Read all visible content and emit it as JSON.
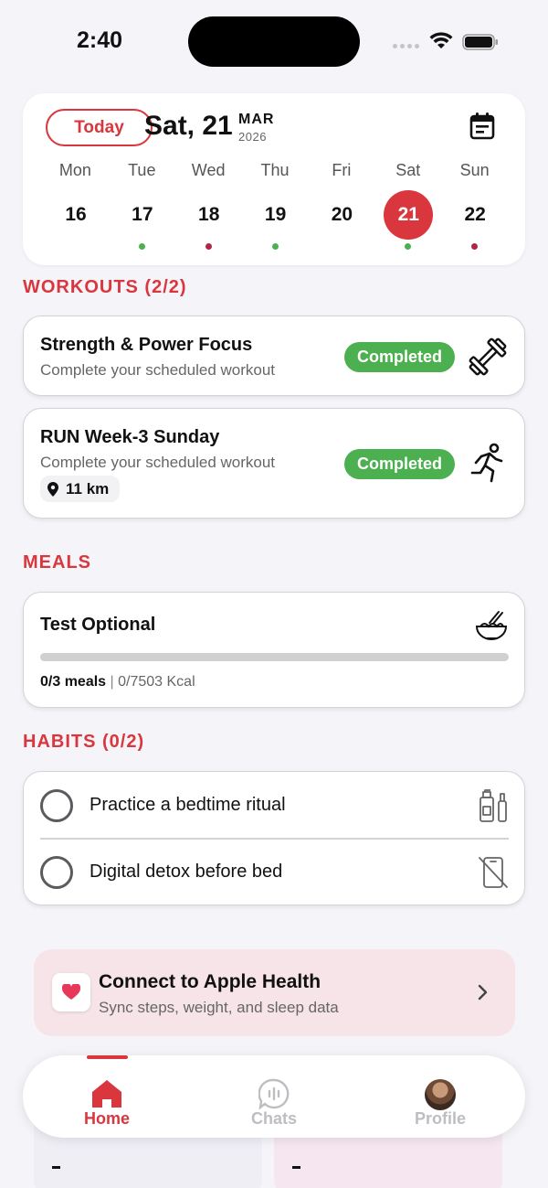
{
  "status_bar": {
    "time": "2:40"
  },
  "calendar": {
    "today_label": "Today",
    "date_label": "Sat, 21",
    "month": "MAR",
    "year": "2026",
    "days": [
      {
        "name": "Mon",
        "num": "16",
        "dot": null
      },
      {
        "name": "Tue",
        "num": "17",
        "dot": "#4caf50"
      },
      {
        "name": "Wed",
        "num": "18",
        "dot": "#b0264a"
      },
      {
        "name": "Thu",
        "num": "19",
        "dot": "#4caf50"
      },
      {
        "name": "Fri",
        "num": "20",
        "dot": null
      },
      {
        "name": "Sat",
        "num": "21",
        "dot": "#4caf50",
        "selected": true
      },
      {
        "name": "Sun",
        "num": "22",
        "dot": "#b0264a"
      }
    ]
  },
  "workouts": {
    "title": "WORKOUTS (2/2)",
    "items": [
      {
        "title": "Strength & Power Focus",
        "subtitle": "Complete your scheduled workout",
        "status": "Completed",
        "icon": "dumbbell-icon"
      },
      {
        "title": "RUN Week-3 Sunday",
        "subtitle": "Complete your scheduled workout",
        "status": "Completed",
        "icon": "runner-icon",
        "distance": "11 km"
      }
    ]
  },
  "meals": {
    "title": "MEALS",
    "card": {
      "title": "Test Optional",
      "meals_done": "0/3 meals",
      "separator": "|",
      "kcal": "0/7503 Kcal",
      "progress": 0,
      "icon": "noodle-bowl-icon"
    }
  },
  "habits": {
    "title": "HABITS (0/2)",
    "items": [
      {
        "label": "Practice a bedtime ritual",
        "icon": "toiletries-icon",
        "done": false
      },
      {
        "label": "Digital detox before bed",
        "icon": "no-phone-icon",
        "done": false
      }
    ]
  },
  "apple_health": {
    "title": "Connect to Apple Health",
    "subtitle": "Sync steps, weight, and sleep data",
    "icon": "heart-icon"
  },
  "tab_bar": {
    "tabs": [
      {
        "label": "Home",
        "icon": "home-icon",
        "active": true
      },
      {
        "label": "Chats",
        "icon": "chat-icon",
        "active": false
      },
      {
        "label": "Profile",
        "icon": "avatar",
        "active": false
      }
    ]
  },
  "peek_cards": {
    "value_a": "-",
    "value_b": "-"
  },
  "colors": {
    "accent": "#d9363e",
    "success": "#4caf50",
    "dot_red": "#b0264a"
  }
}
